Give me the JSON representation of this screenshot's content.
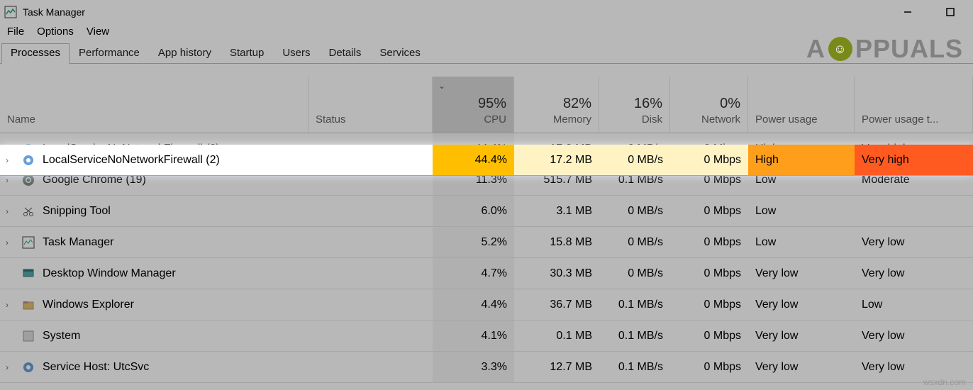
{
  "window": {
    "title": "Task Manager"
  },
  "menu": {
    "file": "File",
    "options": "Options",
    "view": "View"
  },
  "tabs": {
    "processes": "Processes",
    "performance": "Performance",
    "app_history": "App history",
    "startup": "Startup",
    "users": "Users",
    "details": "Details",
    "services": "Services"
  },
  "columns": {
    "name": "Name",
    "status": "Status",
    "cpu_pct": "95%",
    "cpu": "CPU",
    "mem_pct": "82%",
    "memory": "Memory",
    "disk_pct": "16%",
    "disk": "Disk",
    "net_pct": "0%",
    "network": "Network",
    "power": "Power usage",
    "power_trend": "Power usage t..."
  },
  "rows": [
    {
      "name": "LocalServiceNoNetworkFirewall (2)",
      "expandable": true,
      "cpu": "44.4%",
      "memory": "17.2 MB",
      "disk": "0 MB/s",
      "network": "0 Mbps",
      "power": "High",
      "power_trend": "Very high",
      "highlight": true
    },
    {
      "name": "Google Chrome (19)",
      "expandable": true,
      "cpu": "11.3%",
      "memory": "515.7 MB",
      "disk": "0.1 MB/s",
      "network": "0 Mbps",
      "power": "Low",
      "power_trend": "Moderate"
    },
    {
      "name": "Snipping Tool",
      "expandable": true,
      "cpu": "6.0%",
      "memory": "3.1 MB",
      "disk": "0 MB/s",
      "network": "0 Mbps",
      "power": "Low",
      "power_trend": ""
    },
    {
      "name": "Task Manager",
      "expandable": true,
      "cpu": "5.2%",
      "memory": "15.8 MB",
      "disk": "0 MB/s",
      "network": "0 Mbps",
      "power": "Low",
      "power_trend": "Very low"
    },
    {
      "name": "Desktop Window Manager",
      "expandable": false,
      "cpu": "4.7%",
      "memory": "30.3 MB",
      "disk": "0 MB/s",
      "network": "0 Mbps",
      "power": "Very low",
      "power_trend": "Very low"
    },
    {
      "name": "Windows Explorer",
      "expandable": true,
      "cpu": "4.4%",
      "memory": "36.7 MB",
      "disk": "0.1 MB/s",
      "network": "0 Mbps",
      "power": "Very low",
      "power_trend": "Low"
    },
    {
      "name": "System",
      "expandable": false,
      "cpu": "4.1%",
      "memory": "0.1 MB",
      "disk": "0.1 MB/s",
      "network": "0 Mbps",
      "power": "Very low",
      "power_trend": "Very low"
    },
    {
      "name": "Service Host: UtcSvc",
      "expandable": true,
      "cpu": "3.3%",
      "memory": "12.7 MB",
      "disk": "0.1 MB/s",
      "network": "0 Mbps",
      "power": "Very low",
      "power_trend": "Very low"
    }
  ],
  "watermark": {
    "text": "PPUALS"
  },
  "source": "wsxdn.com"
}
